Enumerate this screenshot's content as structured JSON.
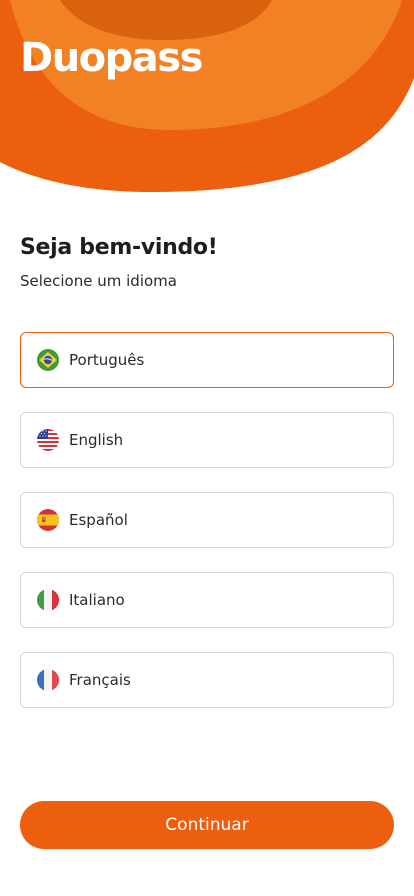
{
  "brand": {
    "name": "Duopass"
  },
  "welcome": {
    "title": "Seja bem-vindo!",
    "subtitle": "Selecione um idioma"
  },
  "languages": {
    "selected": "Português",
    "options": [
      {
        "label": "Português",
        "flag": "brazil-flag-icon"
      },
      {
        "label": "English",
        "flag": "usa-flag-icon"
      },
      {
        "label": "Español",
        "flag": "spain-flag-icon"
      },
      {
        "label": "Italiano",
        "flag": "italy-flag-icon"
      },
      {
        "label": "Français",
        "flag": "france-flag-icon"
      }
    ]
  },
  "actions": {
    "continue_label": "Continuar"
  },
  "colors": {
    "accent": "#ec5f0f",
    "header_mid": "#f07a22",
    "header_dark": "#d9620f"
  }
}
